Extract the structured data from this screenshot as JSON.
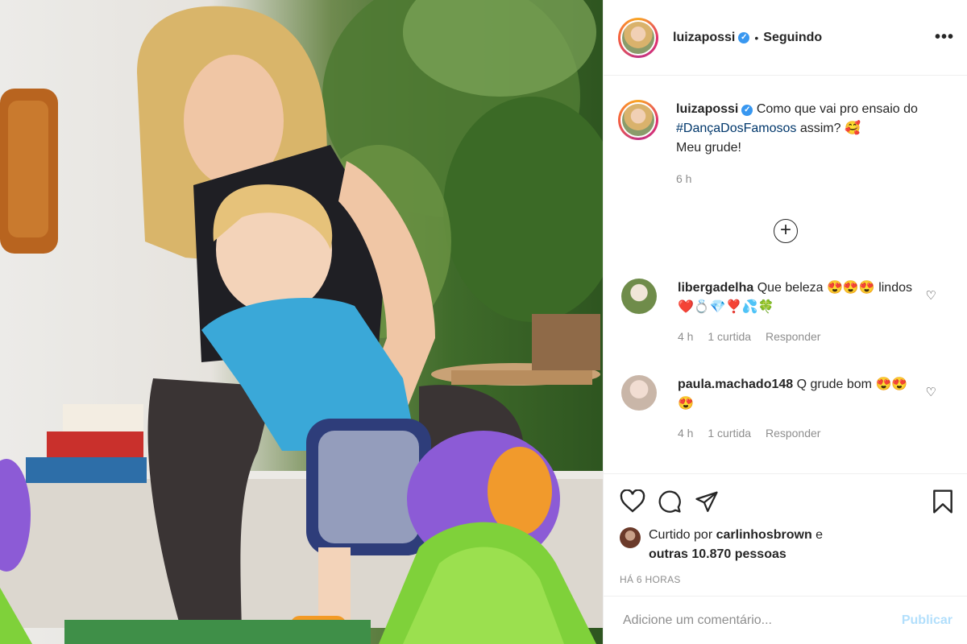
{
  "post": {
    "author": "luizapossi",
    "follow_status": "Seguindo",
    "more_label": "•••",
    "caption_prefix": "Como que vai pro ensaio do ",
    "caption_hashtag": "#DançaDosFamosos",
    "caption_suffix": " assim? 🥰",
    "caption_line2": "Meu grude!",
    "caption_time": "6 h",
    "load_more": "+"
  },
  "comments": [
    {
      "user": "libergadelha",
      "text": "Que beleza 😍😍😍 lindos ❤️💍💎❣️💦🍀",
      "time": "4 h",
      "likes": "1 curtida",
      "reply": "Responder"
    },
    {
      "user": "paula.machado148",
      "text": "Q grude bom 😍😍😍",
      "time": "4 h",
      "likes": "1 curtida",
      "reply": "Responder"
    }
  ],
  "likes": {
    "prefix": "Curtido por ",
    "user": "carlinhosbrown",
    "conj": " e",
    "others": "outras 10.870 pessoas"
  },
  "posted_ago": "HÁ 6 HORAS",
  "comment_box": {
    "placeholder": "Adicione um comentário...",
    "publish": "Publicar"
  },
  "colors": {
    "verified": "#3897f0",
    "hashtag": "#00376b",
    "publish": "#b2dffc",
    "muted": "#8e8e8e"
  }
}
